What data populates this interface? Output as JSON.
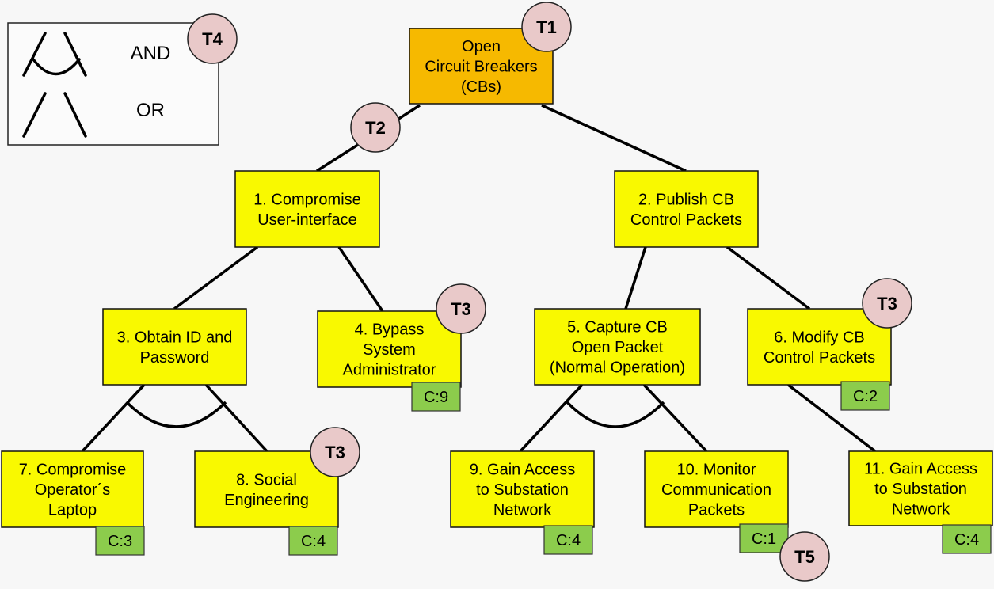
{
  "legend": {
    "and_label": "AND",
    "or_label": "OR",
    "badge": "T4"
  },
  "colors": {
    "root": "#f6b900",
    "node": "#f9f900",
    "cost": "#8ccc4c",
    "badge": "#e9c9c9",
    "line": "#000000",
    "background": "#f7f7f7"
  },
  "nodes": [
    {
      "id": "root",
      "lines": [
        "Open",
        "Circuit Breakers",
        "(CBs)"
      ],
      "badge": "T1"
    },
    {
      "id": "n1",
      "lines": [
        "1. Compromise",
        "User-interface"
      ]
    },
    {
      "id": "n2",
      "lines": [
        "2. Publish CB",
        "Control Packets"
      ]
    },
    {
      "id": "n3",
      "lines": [
        "3. Obtain ID and",
        "Password"
      ]
    },
    {
      "id": "n4",
      "lines": [
        "4. Bypass",
        "System",
        "Administrator"
      ],
      "cost": "C:9",
      "badge": "T3"
    },
    {
      "id": "n5",
      "lines": [
        "5. Capture CB",
        "Open Packet",
        "(Normal Operation)"
      ]
    },
    {
      "id": "n6",
      "lines": [
        "6. Modify CB",
        "Control Packets"
      ],
      "cost": "C:2",
      "badge": "T3"
    },
    {
      "id": "n7",
      "lines": [
        "7. Compromise",
        "Operator´s",
        "Laptop"
      ],
      "cost": "C:3"
    },
    {
      "id": "n8",
      "lines": [
        "8. Social",
        "Engineering"
      ],
      "cost": "C:4",
      "badge": "T3"
    },
    {
      "id": "n9",
      "lines": [
        "9. Gain Access",
        "to Substation",
        "Network"
      ],
      "cost": "C:4"
    },
    {
      "id": "n10",
      "lines": [
        "10. Monitor",
        "Communication",
        "Packets"
      ],
      "cost": "C:1",
      "badge": "T5"
    },
    {
      "id": "n11",
      "lines": [
        "11. Gain Access",
        "to Substation",
        "Network"
      ],
      "cost": "C:4"
    }
  ],
  "edge_badges": [
    {
      "edge": "root-n1",
      "label": "T2"
    }
  ],
  "edges": [
    {
      "from": "root",
      "to": "n1"
    },
    {
      "from": "root",
      "to": "n2"
    },
    {
      "from": "n1",
      "to": "n3"
    },
    {
      "from": "n1",
      "to": "n4"
    },
    {
      "from": "n2",
      "to": "n5"
    },
    {
      "from": "n2",
      "to": "n6"
    },
    {
      "from": "n3",
      "to": "n7",
      "gate": "AND"
    },
    {
      "from": "n3",
      "to": "n8",
      "gate": "AND"
    },
    {
      "from": "n5",
      "to": "n9",
      "gate": "AND"
    },
    {
      "from": "n5",
      "to": "n10",
      "gate": "AND"
    },
    {
      "from": "n6",
      "to": "n11"
    }
  ]
}
